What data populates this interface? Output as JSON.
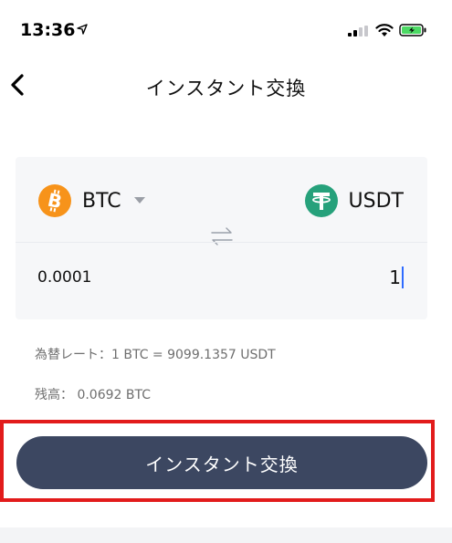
{
  "status_bar": {
    "time": "13:36"
  },
  "nav": {
    "title": "インスタント交換"
  },
  "exchange": {
    "from_coin": "BTC",
    "to_coin": "USDT",
    "from_amount": "0.0001",
    "to_amount": "1"
  },
  "info": {
    "rate": "為替レート：1 BTC = 9099.1357 USDT",
    "balance": "残高： 0.0692 BTC"
  },
  "button": {
    "label": "インスタント交換"
  },
  "colors": {
    "button_bg": "#3c4761",
    "btc": "#f7931a",
    "usdt": "#26a17b",
    "highlight": "#e21b1b",
    "battery": "#4cd964"
  }
}
